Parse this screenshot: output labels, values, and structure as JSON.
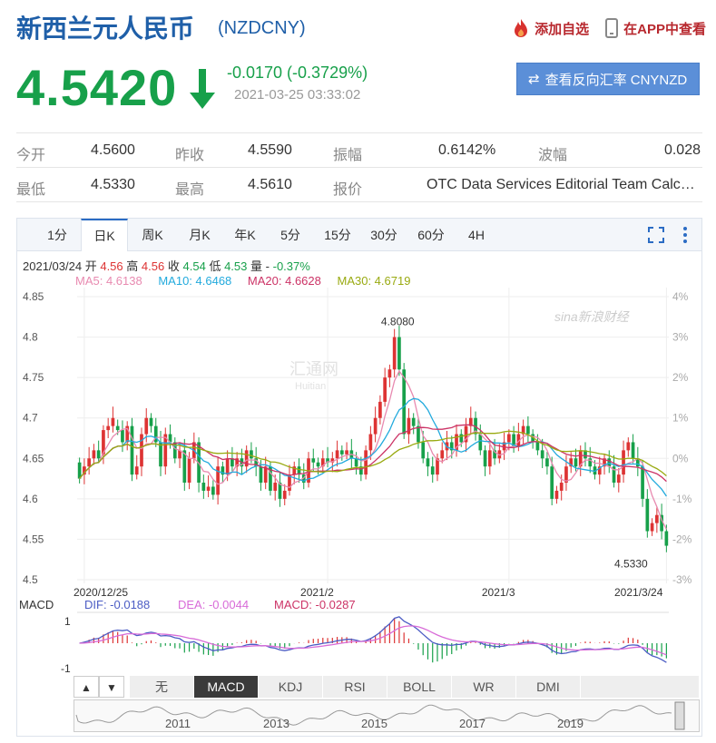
{
  "header": {
    "title": "新西兰元人民币",
    "code": "(NZDCNY)",
    "add_watchlist": "添加自选",
    "view_in_app": "在APP中查看"
  },
  "quote": {
    "price": "4.5420",
    "change": "-0.0170 (-0.3729%)",
    "datetime": "2021-03-25 03:33:02",
    "reverse_button": "查看反向汇率 CNYNZD"
  },
  "stats": {
    "open_label": "今开",
    "open": "4.5600",
    "prev_close_label": "昨收",
    "prev_close": "4.5590",
    "amplitude_label": "振幅",
    "amplitude": "0.6142%",
    "wave_label": "波幅",
    "wave": "0.028",
    "low_label": "最低",
    "low": "4.5330",
    "high_label": "最高",
    "high": "4.5610",
    "quote_label": "报价",
    "quote_source": "OTC Data Services Editorial Team Calc…"
  },
  "period_tabs": [
    "1分",
    "日K",
    "周K",
    "月K",
    "年K",
    "5分",
    "15分",
    "30分",
    "60分",
    "4H"
  ],
  "ohlc": {
    "date": "2021/03/24",
    "open_label": "开",
    "open": "4.56",
    "high_label": "高",
    "high": "4.56",
    "close_label": "收",
    "close": "4.54",
    "low_label": "低",
    "low": "4.53",
    "vol_label": "量",
    "vol": "-",
    "pct": "-0.37%"
  },
  "ma": {
    "ma5": "MA5: 4.6138",
    "ma10": "MA10: 4.6468",
    "ma20": "MA20: 4.6628",
    "ma30": "MA30: 4.6719"
  },
  "macd_legend": {
    "name": "MACD",
    "dif": "DIF: -0.0188",
    "dea": "DEA: -0.0044",
    "macd": "MACD: -0.0287"
  },
  "indicator_tabs": [
    "无",
    "MACD",
    "KDJ",
    "RSI",
    "BOLL",
    "WR",
    "DMI"
  ],
  "nav": {
    "prev": "▲",
    "next": "▼"
  },
  "watermark": {
    "brand": "sina新浪财经",
    "huadian": "汇通网",
    "huadian_en": "Huitian"
  },
  "colors": {
    "up": "#dd3333",
    "down": "#17a04a",
    "ma5": "#e88ab0",
    "ma10": "#22aadd",
    "ma20": "#cc3366",
    "ma30": "#99aa11",
    "dif": "#4b5cc4",
    "dea": "#d86bd8"
  },
  "chart_data": {
    "type": "candlestick",
    "y_ticks": [
      "4.85",
      "4.8",
      "4.75",
      "4.7",
      "4.65",
      "4.6",
      "4.55",
      "4.5"
    ],
    "ylim": [
      4.5,
      4.85
    ],
    "pct_ticks": [
      "4%",
      "3%",
      "2%",
      "1%",
      "0%",
      "-1%",
      "-2%",
      "-3%"
    ],
    "x_labels": [
      "2020/12/25",
      "2021/2",
      "2021/3",
      "2021/3/24"
    ],
    "x_label_index": [
      1,
      52,
      90,
      123
    ],
    "max_label": "4.8080",
    "min_label": "4.5330",
    "candles": [
      [
        4.645,
        4.625
      ],
      [
        4.63,
        4.64
      ],
      [
        4.64,
        4.65
      ],
      [
        4.65,
        4.66
      ],
      [
        4.66,
        4.65
      ],
      [
        4.655,
        4.685
      ],
      [
        4.685,
        4.69
      ],
      [
        4.69,
        4.7
      ],
      [
        4.69,
        4.685
      ],
      [
        4.685,
        4.67
      ],
      [
        4.67,
        4.69
      ],
      [
        4.69,
        4.63
      ],
      [
        4.63,
        4.64
      ],
      [
        4.64,
        4.68
      ],
      [
        4.68,
        4.7
      ],
      [
        4.7,
        4.69
      ],
      [
        4.69,
        4.67
      ],
      [
        4.67,
        4.64
      ],
      [
        4.64,
        4.68
      ],
      [
        4.68,
        4.67
      ],
      [
        4.67,
        4.65
      ],
      [
        4.65,
        4.66
      ],
      [
        4.66,
        4.62
      ],
      [
        4.62,
        4.65
      ],
      [
        4.65,
        4.67
      ],
      [
        4.67,
        4.62
      ],
      [
        4.62,
        4.61
      ],
      [
        4.61,
        4.615
      ],
      [
        4.615,
        4.605
      ],
      [
        4.605,
        4.64
      ],
      [
        4.64,
        4.63
      ],
      [
        4.63,
        4.65
      ],
      [
        4.65,
        4.64
      ],
      [
        4.64,
        4.65
      ],
      [
        4.65,
        4.64
      ],
      [
        4.64,
        4.66
      ],
      [
        4.66,
        4.65
      ],
      [
        4.65,
        4.64
      ],
      [
        4.64,
        4.62
      ],
      [
        4.62,
        4.64
      ],
      [
        4.64,
        4.61
      ],
      [
        4.61,
        4.62
      ],
      [
        4.62,
        4.6
      ],
      [
        4.6,
        4.61
      ],
      [
        4.61,
        4.63
      ],
      [
        4.63,
        4.64
      ],
      [
        4.64,
        4.63
      ],
      [
        4.63,
        4.62
      ],
      [
        4.62,
        4.65
      ],
      [
        4.65,
        4.645
      ],
      [
        4.645,
        4.64
      ],
      [
        4.64,
        4.65
      ],
      [
        4.65,
        4.645
      ],
      [
        4.645,
        4.65
      ],
      [
        4.65,
        4.66
      ],
      [
        4.66,
        4.655
      ],
      [
        4.655,
        4.66
      ],
      [
        4.66,
        4.65
      ],
      [
        4.65,
        4.64
      ],
      [
        4.64,
        4.63
      ],
      [
        4.63,
        4.66
      ],
      [
        4.66,
        4.68
      ],
      [
        4.68,
        4.7
      ],
      [
        4.7,
        4.72
      ],
      [
        4.72,
        4.75
      ],
      [
        4.75,
        4.76
      ],
      [
        4.76,
        4.8
      ],
      [
        4.8,
        4.76
      ],
      [
        4.76,
        4.68
      ],
      [
        4.68,
        4.7
      ],
      [
        4.7,
        4.69
      ],
      [
        4.69,
        4.67
      ],
      [
        4.67,
        4.65
      ],
      [
        4.65,
        4.64
      ],
      [
        4.64,
        4.63
      ],
      [
        4.63,
        4.65
      ],
      [
        4.65,
        4.66
      ],
      [
        4.66,
        4.67
      ],
      [
        4.67,
        4.66
      ],
      [
        4.66,
        4.68
      ],
      [
        4.68,
        4.67
      ],
      [
        4.67,
        4.69
      ],
      [
        4.69,
        4.7
      ],
      [
        4.7,
        4.68
      ],
      [
        4.68,
        4.66
      ],
      [
        4.66,
        4.64
      ],
      [
        4.64,
        4.66
      ],
      [
        4.66,
        4.65
      ],
      [
        4.65,
        4.66
      ],
      [
        4.66,
        4.67
      ],
      [
        4.67,
        4.68
      ],
      [
        4.68,
        4.665
      ],
      [
        4.665,
        4.68
      ],
      [
        4.68,
        4.69
      ],
      [
        4.69,
        4.68
      ],
      [
        4.68,
        4.67
      ],
      [
        4.67,
        4.66
      ],
      [
        4.66,
        4.65
      ],
      [
        4.65,
        4.64
      ],
      [
        4.64,
        4.6
      ],
      [
        4.6,
        4.61
      ],
      [
        4.61,
        4.62
      ],
      [
        4.62,
        4.64
      ],
      [
        4.64,
        4.65
      ],
      [
        4.65,
        4.64
      ],
      [
        4.64,
        4.66
      ],
      [
        4.66,
        4.65
      ],
      [
        4.65,
        4.64
      ],
      [
        4.64,
        4.63
      ],
      [
        4.63,
        4.64
      ],
      [
        4.64,
        4.65
      ],
      [
        4.65,
        4.64
      ],
      [
        4.64,
        4.62
      ],
      [
        4.62,
        4.63
      ],
      [
        4.63,
        4.66
      ],
      [
        4.66,
        4.67
      ],
      [
        4.67,
        4.65
      ],
      [
        4.65,
        4.64
      ],
      [
        4.64,
        4.6
      ],
      [
        4.6,
        4.56
      ],
      [
        4.56,
        4.57
      ],
      [
        4.57,
        4.58
      ],
      [
        4.58,
        4.56
      ],
      [
        4.56,
        4.542
      ]
    ]
  },
  "timeline_years": [
    "2011",
    "2013",
    "2015",
    "2017",
    "2019"
  ]
}
